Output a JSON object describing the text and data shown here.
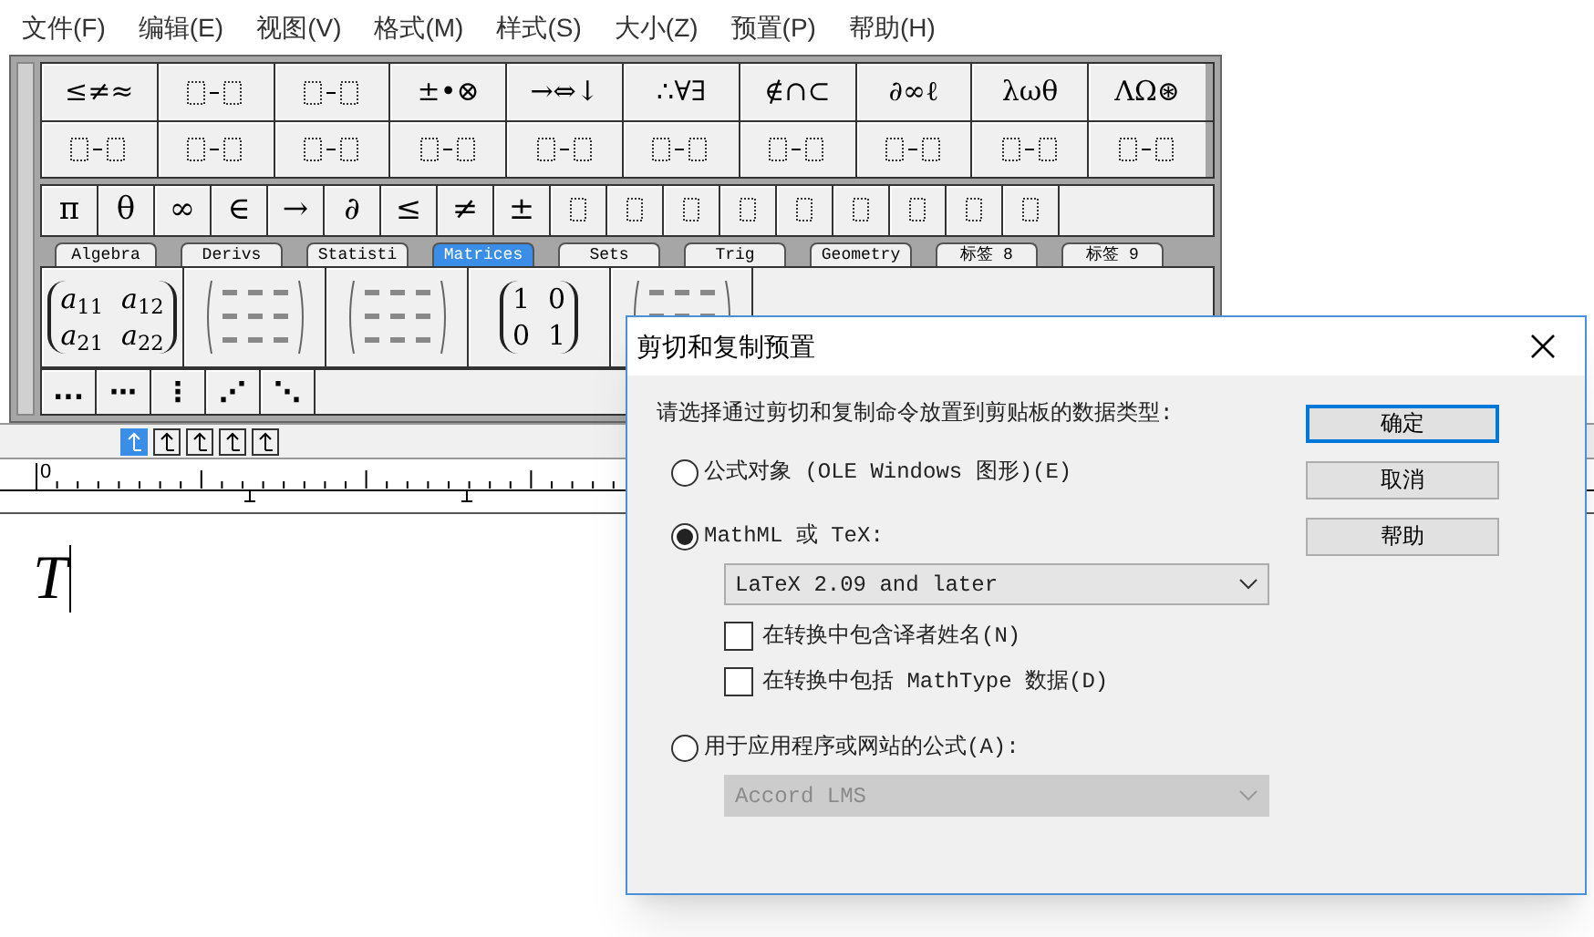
{
  "menu": [
    "文件(F)",
    "编辑(E)",
    "视图(V)",
    "格式(M)",
    "样式(S)",
    "大小(Z)",
    "预置(P)",
    "帮助(H)"
  ],
  "palette_rows": [
    [
      {
        "kind": "text",
        "label": "≤≠≈"
      },
      {
        "kind": "icon"
      },
      {
        "kind": "icon"
      },
      {
        "kind": "text",
        "label": "±•⊗"
      },
      {
        "kind": "text",
        "label": "→⇔↓"
      },
      {
        "kind": "text",
        "label": "∴∀∃"
      },
      {
        "kind": "text",
        "label": "∉∩⊂"
      },
      {
        "kind": "text",
        "label": "∂∞ℓ"
      },
      {
        "kind": "text",
        "label": "λωθ"
      },
      {
        "kind": "text",
        "label": "ΛΩ⊛"
      }
    ],
    [
      {
        "kind": "icon"
      },
      {
        "kind": "icon"
      },
      {
        "kind": "icon"
      },
      {
        "kind": "icon"
      },
      {
        "kind": "icon"
      },
      {
        "kind": "icon"
      },
      {
        "kind": "icon"
      },
      {
        "kind": "icon"
      },
      {
        "kind": "icon"
      },
      {
        "kind": "icon"
      }
    ]
  ],
  "symbol_bar": [
    {
      "kind": "text",
      "label": "π"
    },
    {
      "kind": "text",
      "label": "θ"
    },
    {
      "kind": "text",
      "label": "∞"
    },
    {
      "kind": "text",
      "label": "∈"
    },
    {
      "kind": "text",
      "label": "→"
    },
    {
      "kind": "text",
      "label": "∂"
    },
    {
      "kind": "text",
      "label": "≤"
    },
    {
      "kind": "text",
      "label": "≠"
    },
    {
      "kind": "text",
      "label": "±"
    },
    {
      "kind": "icon"
    },
    {
      "kind": "icon"
    },
    {
      "kind": "icon"
    },
    {
      "kind": "icon"
    },
    {
      "kind": "icon"
    },
    {
      "kind": "icon"
    },
    {
      "kind": "icon"
    },
    {
      "kind": "icon"
    },
    {
      "kind": "icon"
    }
  ],
  "tabs": [
    {
      "label": "Algebra",
      "selected": false
    },
    {
      "label": "Derivs",
      "selected": false
    },
    {
      "label": "Statisti",
      "selected": false
    },
    {
      "label": "Matrices",
      "selected": true
    },
    {
      "label": "Sets",
      "selected": false
    },
    {
      "label": "Trig",
      "selected": false
    },
    {
      "label": "Geometry",
      "selected": false
    },
    {
      "label": "标签 8",
      "selected": false
    },
    {
      "label": "标签 9",
      "selected": false
    }
  ],
  "templates": [
    {
      "kind": "matrix",
      "cells": [
        "*a*$_{11}$",
        "*a*$_{12}$",
        "*a*$_{21}$",
        "*a*$_{22}$"
      ]
    },
    {
      "kind": "icon"
    },
    {
      "kind": "icon"
    },
    {
      "kind": "matrix",
      "cells": [
        "1",
        "0",
        "0",
        "1"
      ]
    },
    {
      "kind": "icon"
    }
  ],
  "dots_bar": [
    "...",
    "⋯",
    "⋮",
    "⋰",
    "⋱"
  ],
  "nudge_buttons": [
    {
      "selected": true
    },
    {
      "selected": false
    },
    {
      "selected": false
    },
    {
      "selected": false
    },
    {
      "selected": false
    }
  ],
  "ruler": {
    "label": "0"
  },
  "editor": {
    "content": "T"
  },
  "dialog": {
    "title": "剪切和复制预置",
    "prompt": "请选择通过剪切和复制命令放置到剪贴板的数据类型:",
    "buttons": [
      {
        "label": "确定",
        "default": true
      },
      {
        "label": "取消",
        "default": false
      },
      {
        "label": "帮助",
        "default": false
      }
    ],
    "options": [
      {
        "kind": "radio",
        "label": "公式对象 (OLE Windows 图形)(E)",
        "selected": false
      },
      {
        "kind": "radio",
        "label": "MathML 或 TeX:",
        "selected": true
      },
      {
        "kind": "dropdown",
        "value": "LaTeX 2.09 and later",
        "disabled": false
      },
      {
        "kind": "checkbox",
        "label": "在转换中包含译者姓名(N)",
        "checked": false
      },
      {
        "kind": "checkbox",
        "label": "在转换中包括 MathType 数据(D)",
        "checked": false
      },
      {
        "kind": "radio",
        "label": "用于应用程序或网站的公式(A):",
        "selected": false
      },
      {
        "kind": "dropdown",
        "value": "Accord LMS",
        "disabled": true
      }
    ]
  }
}
